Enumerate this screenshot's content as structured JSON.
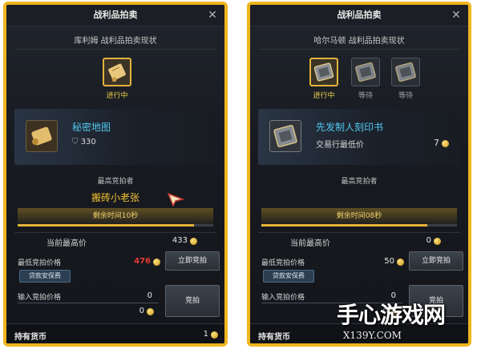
{
  "left_panel": {
    "title": "战利品拍卖",
    "subtitle": "库利姆 战利品拍卖现状",
    "slot_status": "进行中",
    "item": {
      "name": "秘密地图",
      "sub_value": "330"
    },
    "highest_bidder_label": "最高竞拍者",
    "highest_bidder": "搬砖小老张",
    "timer_text": "剩余时间10秒",
    "timer_progress": 0.9,
    "current_price_label": "当前最高价",
    "current_price": "433",
    "min_bid_label": "最低竞拍价格",
    "min_bid_value": "476",
    "loan_button": "贷款安保费",
    "buy_now_button": "立即竞拍",
    "input_label": "输入竞拍价格",
    "input_value": "0",
    "coin_value": "0",
    "bid_button": "竞拍",
    "wallet_label": "持有货币",
    "wallet_value": "1"
  },
  "right_panel": {
    "title": "战利品拍卖",
    "subtitle": "哈尔马顿 战利品拍卖现状",
    "slots": [
      {
        "status": "进行中"
      },
      {
        "status": "等待"
      },
      {
        "status": "等待"
      }
    ],
    "item": {
      "name": "先发制人刻印书",
      "sub_label": "交易行最低价",
      "count": "7"
    },
    "highest_bidder_label": "最高竞拍者",
    "timer_text": "剩余时间08秒",
    "timer_progress": 0.85,
    "current_price_label": "当前最高价",
    "current_price": "0",
    "min_bid_label": "最低竞拍价格",
    "min_bid_value": "50",
    "loan_button": "贷款安保费",
    "buy_now_button": "立即竞拍",
    "input_label": "输入竞拍价格",
    "input_value": "0",
    "coin_value": "0",
    "bid_button": "竞拍",
    "wallet_label": "持有货币"
  },
  "watermark": {
    "main": "手心游戏网",
    "sub": "X139Y.COM"
  },
  "colors": {
    "accent": "#f0b51e",
    "item_name": "#52c7ee",
    "bidder": "#f1c232",
    "min_bid_red": "#e53935"
  },
  "icons": [
    "close-icon",
    "scroll-icon",
    "map-icon",
    "shield-icon",
    "book-icon",
    "coin-icon",
    "cursor-icon"
  ]
}
